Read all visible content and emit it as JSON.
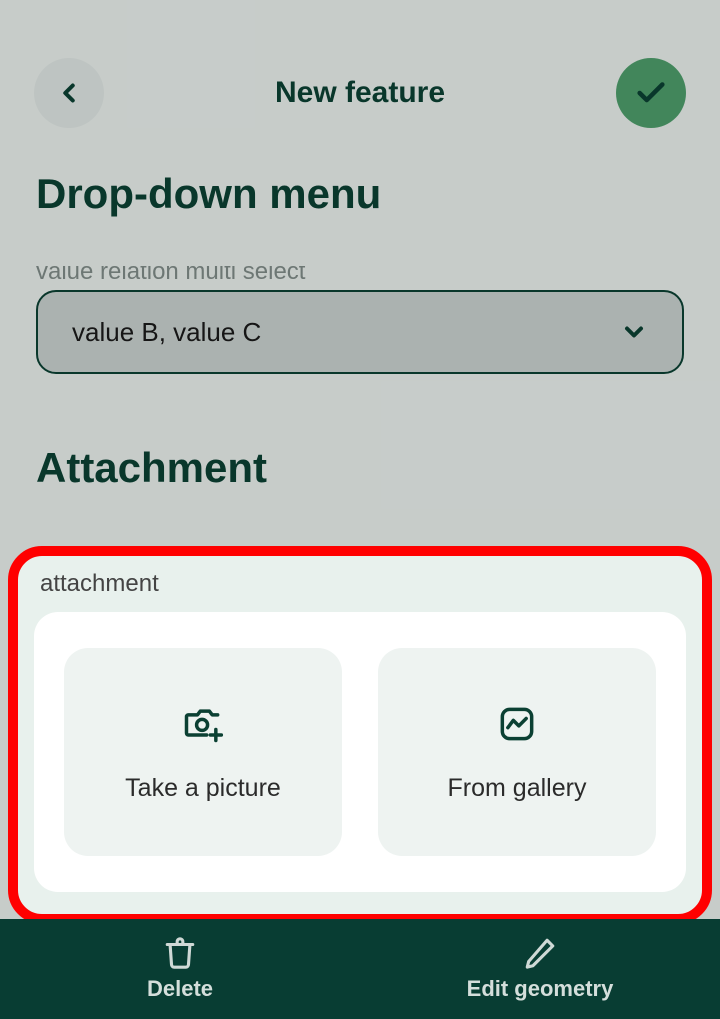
{
  "header": {
    "title": "New feature"
  },
  "sections": {
    "dropdown_title": "Drop-down menu",
    "attachment_title": "Attachment"
  },
  "dropdown_field": {
    "label": "value relation multi select",
    "value": "value B, value C"
  },
  "attachment": {
    "label": "attachment",
    "take_picture": "Take a picture",
    "from_gallery": "From gallery"
  },
  "bottombar": {
    "delete": "Delete",
    "edit_geometry": "Edit geometry"
  },
  "colors": {
    "brand_dark": "#0b4033",
    "accent_green": "#4d9d6a",
    "highlight_red": "#ff0000",
    "bottom_bg": "#083d33"
  },
  "icons": {
    "back": "chevron-left-icon",
    "confirm": "check-icon",
    "dropdown": "chevron-down-icon",
    "camera": "camera-plus-icon",
    "gallery": "image-trend-icon",
    "delete": "trash-icon",
    "edit": "pencil-icon"
  }
}
